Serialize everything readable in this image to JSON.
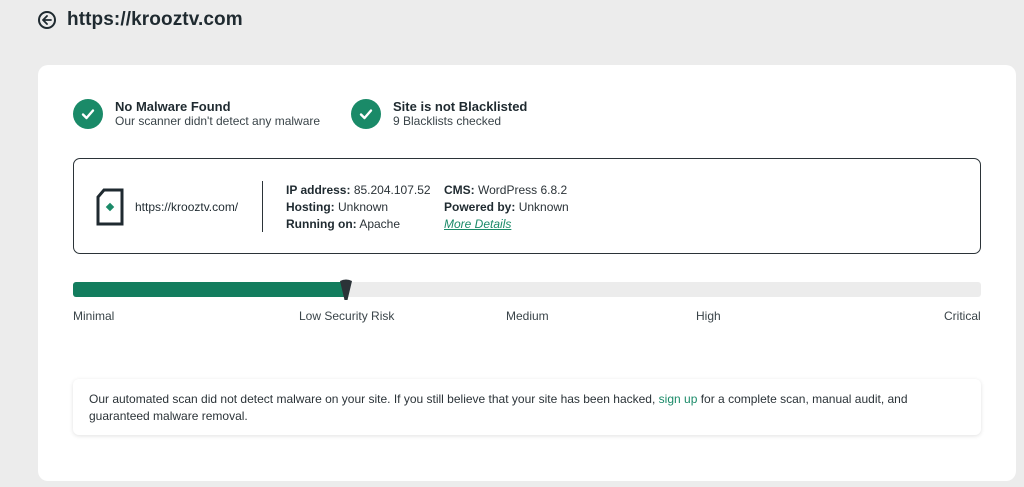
{
  "header": {
    "title": "https://krooztv.com",
    "back_icon": "arrow-left-circle-icon"
  },
  "status": [
    {
      "title": "No Malware Found",
      "subtitle": "Our scanner didn't detect any malware",
      "icon": "check-circle-icon"
    },
    {
      "title": "Site is not Blacklisted",
      "subtitle": "9 Blacklists checked",
      "icon": "check-circle-icon"
    }
  ],
  "site_info": {
    "url": "https://krooztv.com/",
    "site_icon": "site-document-icon",
    "ip_label": "IP address:",
    "ip_value": "85.204.107.52",
    "hosting_label": "Hosting:",
    "hosting_value": "Unknown",
    "running_label": "Running on:",
    "running_value": "Apache",
    "cms_label": "CMS:",
    "cms_value": "WordPress 6.8.2",
    "powered_label": "Powered by:",
    "powered_value": "Unknown",
    "more_details": "More Details"
  },
  "risk": {
    "level_fraction": 0.301,
    "labels": [
      "Minimal",
      "Low Security Risk",
      "Medium",
      "High",
      "Critical"
    ],
    "fill_color": "#137d5e"
  },
  "notice": {
    "text_before": "Our automated scan did not detect malware on your site. If you still believe that your site has been hacked,",
    "link_text": "sign up",
    "text_after": "for a complete scan, manual audit, and guaranteed malware removal."
  },
  "colors": {
    "accent": "#1a8a68",
    "text": "#1f2a30",
    "background": "#ececec"
  }
}
